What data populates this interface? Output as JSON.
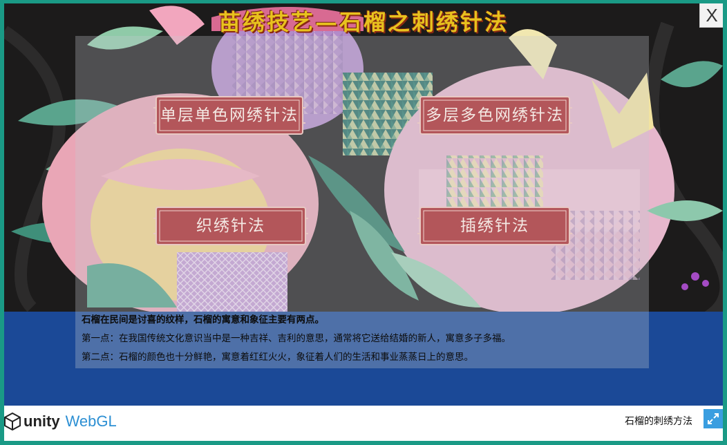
{
  "page": {
    "title": "苗绣技艺—石榴之刺绣针法",
    "close_label": "X"
  },
  "buttons": [
    {
      "label": "单层单色网绣针法"
    },
    {
      "label": "多层多色网绣针法"
    },
    {
      "label": "织绣针法"
    },
    {
      "label": "插绣针法"
    }
  ],
  "info": {
    "line1": "石榴在民间是讨喜的纹样，石榴的寓意和象征主要有两点。",
    "line2": "第一点：在我国传统文化意识当中是一种吉祥、吉利的意思，通常将它送给结婚的新人，寓意多子多福。",
    "line3": "第二点：石榴的颜色也十分鲜艳，寓意着红红火火，象征着人们的生活和事业蒸蒸日上的意思。"
  },
  "footer": {
    "logo_unity": "unity",
    "logo_webgl": "WebGL",
    "app_title": "石榴的刺绣方法",
    "fullscreen_icon": "fullscreen-icon"
  },
  "colors": {
    "frame": "#1a9a86",
    "title": "#e8c21e",
    "button": "#b3565a",
    "bottom_band": "#1e4fa0",
    "webgl_blue": "#2c8fd3"
  }
}
